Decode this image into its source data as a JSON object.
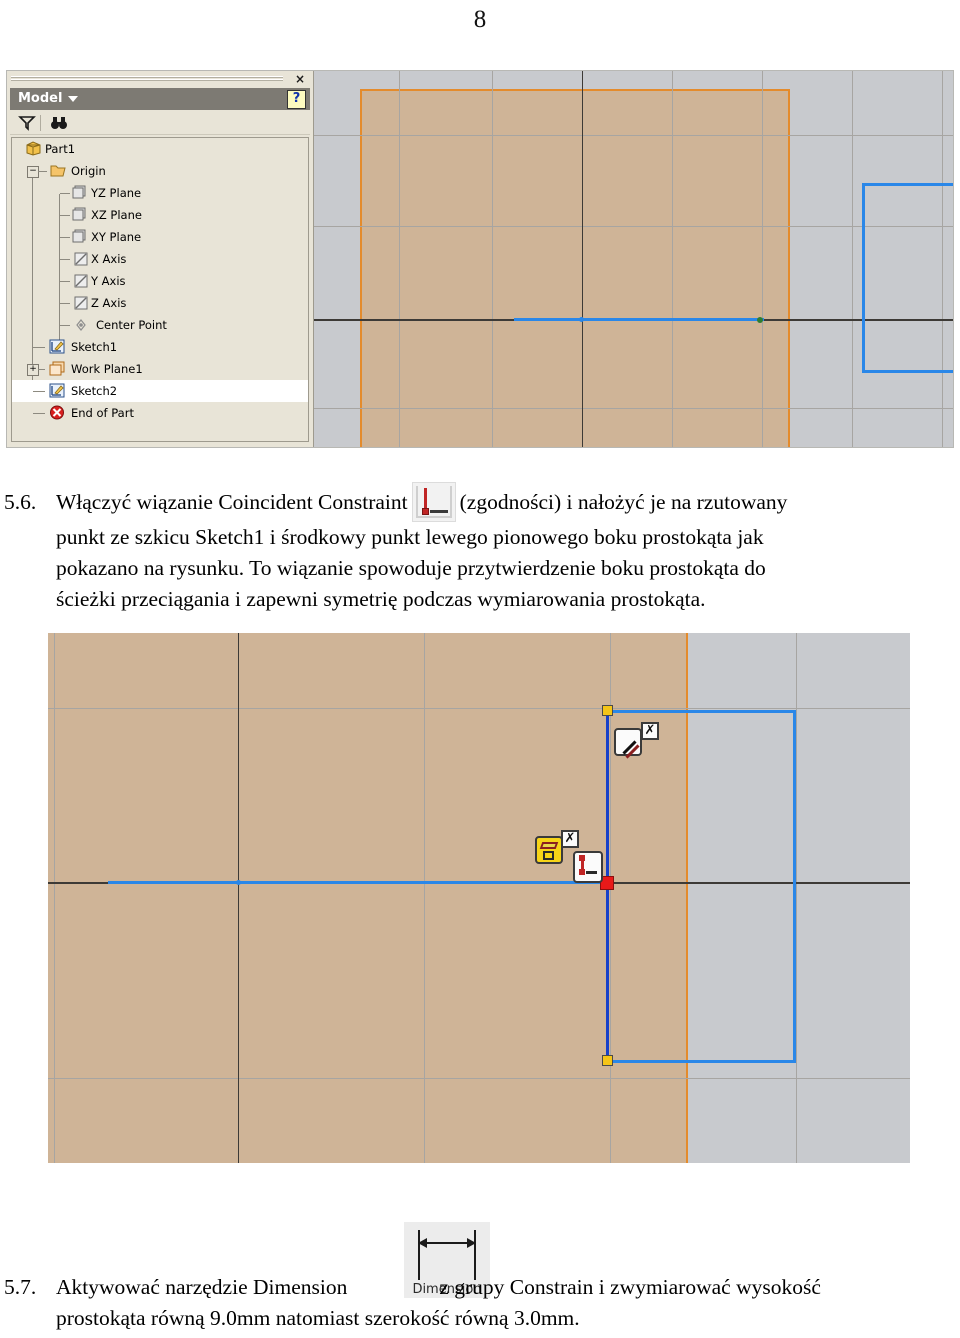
{
  "page": {
    "number": "8"
  },
  "cad_top": {
    "browser": {
      "title": "Model",
      "close_label": "×",
      "help_label": "?",
      "toolbar": [
        {
          "name": "filter-icon",
          "label": "Filter"
        },
        {
          "name": "find-icon",
          "label": "Find"
        }
      ],
      "tree": [
        {
          "label": "Part1",
          "icon": "part-cube-icon",
          "depth": 0,
          "expander": "",
          "selected": false
        },
        {
          "label": "Origin",
          "icon": "folder-icon",
          "depth": 1,
          "expander": "−",
          "selected": false
        },
        {
          "label": "YZ Plane",
          "icon": "plane-icon",
          "depth": 2,
          "expander": "",
          "selected": false
        },
        {
          "label": "XZ Plane",
          "icon": "plane-icon",
          "depth": 2,
          "expander": "",
          "selected": false
        },
        {
          "label": "XY Plane",
          "icon": "plane-icon",
          "depth": 2,
          "expander": "",
          "selected": false
        },
        {
          "label": "X Axis",
          "icon": "axis-icon",
          "depth": 2,
          "expander": "",
          "selected": false
        },
        {
          "label": "Y Axis",
          "icon": "axis-icon",
          "depth": 2,
          "expander": "",
          "selected": false
        },
        {
          "label": "Z Axis",
          "icon": "axis-icon",
          "depth": 2,
          "expander": "",
          "selected": false
        },
        {
          "label": "Center Point",
          "icon": "center-point-icon",
          "depth": 2,
          "expander": "",
          "selected": false
        },
        {
          "label": "Sketch1",
          "icon": "sketch-icon",
          "depth": 1,
          "expander": "",
          "selected": false
        },
        {
          "label": "Work Plane1",
          "icon": "work-plane-icon",
          "depth": 1,
          "expander": "+",
          "selected": false
        },
        {
          "label": "Sketch2",
          "icon": "sketch-icon",
          "depth": 1,
          "expander": "",
          "selected": true
        },
        {
          "label": "End of Part",
          "icon": "end-of-part-icon",
          "depth": 1,
          "expander": "",
          "selected": false
        }
      ]
    },
    "viewport": {
      "background_color": "#c8cace",
      "plane_fill_color": "#cfb497",
      "plane_border_color": "#e48b2c",
      "sketch_color": "#2a87e8",
      "axis_color": "#3d3a36"
    }
  },
  "step_56": {
    "number": "5.6.",
    "lines": [
      "Włączyć wiązanie Coincident Constraint",
      "(zgodności) i nałożyć je na rzutowany",
      "punkt ze szkicu Sketch1 i środkowy punkt lewego pionowego boku prostokąta jak",
      "pokazano na rysunku. To wiązanie spowoduje przytwierdzenie boku prostokąta do",
      "ścieżki przeciągania i zapewni symetrię podczas wymiarowania prostokąta."
    ],
    "inline_icon": "coincident-constraint-icon"
  },
  "cad_bottom": {
    "background_color": "#c8cace",
    "plane_fill_color": "#cfb497",
    "plane_border_color": "#e48b2c",
    "sketch_color": "#2a87e8",
    "selected_point_color": "#e81919",
    "node_color": "#f5c518",
    "glyphs": [
      {
        "name": "parallel-constraint-glyph",
        "badge": "✗"
      },
      {
        "name": "projected-geometry-glyph",
        "badge": "✗"
      },
      {
        "name": "coincident-constraint-glyph",
        "badge": ""
      }
    ]
  },
  "step_57": {
    "number": "5.7.",
    "icon_label": "Dimension",
    "icon_name": "dimension-icon",
    "lines": [
      "Aktywować narzędzie Dimension",
      "z grupy Constrain i zwymiarować wysokość",
      "prostokąta równą 9.0mm natomiast szerokość równą 3.0mm."
    ],
    "height_value": "9.0mm",
    "width_value": "3.0mm"
  }
}
